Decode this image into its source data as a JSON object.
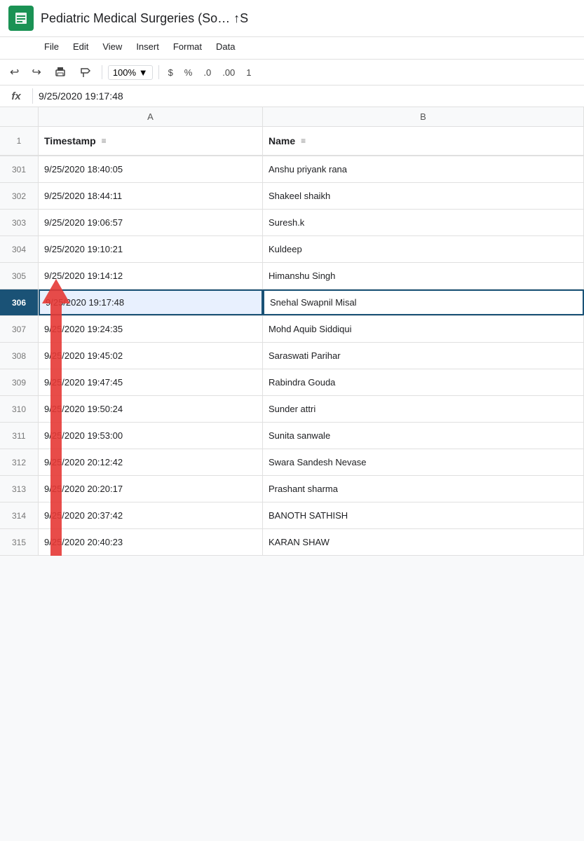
{
  "title": {
    "app_title": "Pediatric Medical Surgeries (So… ↑S",
    "sheets_icon_label": "⊞",
    "formula_content": "9/25/2020 19:17:48"
  },
  "menu": {
    "items": [
      "File",
      "Edit",
      "View",
      "Insert",
      "Format",
      "Data"
    ]
  },
  "toolbar": {
    "undo": "↩",
    "redo": "↪",
    "print": "🖨",
    "paint": "🪣",
    "zoom": "100%",
    "zoom_arrow": "▼",
    "currency": "$",
    "percent": "%",
    "decimal_less": ".0",
    "decimal_more": ".00",
    "more": "1"
  },
  "formula_bar": {
    "fx_label": "fx",
    "value": "9/25/2020 19:17:48"
  },
  "columns": {
    "a_label": "A",
    "b_label": "B"
  },
  "header_row": {
    "row_num": "1",
    "col_a": "Timestamp",
    "col_b": "Name",
    "filter_icon": "≡"
  },
  "rows": [
    {
      "num": "301",
      "timestamp": "9/25/2020 18:40:05",
      "name": "Anshu priyank rana"
    },
    {
      "num": "302",
      "timestamp": "9/25/2020 18:44:11",
      "name": "Shakeel shaikh"
    },
    {
      "num": "303",
      "timestamp": "9/25/2020 19:06:57",
      "name": "Suresh.k"
    },
    {
      "num": "304",
      "timestamp": "9/25/2020 19:10:21",
      "name": "Kuldeep"
    },
    {
      "num": "305",
      "timestamp": "9/25/2020 19:14:12",
      "name": "Himanshu Singh"
    },
    {
      "num": "306",
      "timestamp": "9/25/2020 19:17:48",
      "name": "Snehal Swapnil Misal",
      "selected": true
    },
    {
      "num": "307",
      "timestamp": "9/25/2020 19:24:35",
      "name": "Mohd Aquib Siddiqui"
    },
    {
      "num": "308",
      "timestamp": "9/25/2020 19:45:02",
      "name": "Saraswati Parihar"
    },
    {
      "num": "309",
      "timestamp": "9/25/2020 19:47:45",
      "name": "Rabindra Gouda"
    },
    {
      "num": "310",
      "timestamp": "9/25/2020 19:50:24",
      "name": "Sunder attri"
    },
    {
      "num": "311",
      "timestamp": "9/25/2020 19:53:00",
      "name": "Sunita sanwale"
    },
    {
      "num": "312",
      "timestamp": "9/25/2020 20:12:42",
      "name": "Swara Sandesh Nevase"
    },
    {
      "num": "313",
      "timestamp": "9/25/2020 20:20:17",
      "name": "Prashant sharma"
    },
    {
      "num": "314",
      "timestamp": "9/25/2020 20:37:42",
      "name": "BANOTH SATHISH"
    },
    {
      "num": "315",
      "timestamp": "9/25/2020 20:40:23",
      "name": "KARAN SHAW"
    }
  ],
  "arrow": {
    "visible": true
  }
}
